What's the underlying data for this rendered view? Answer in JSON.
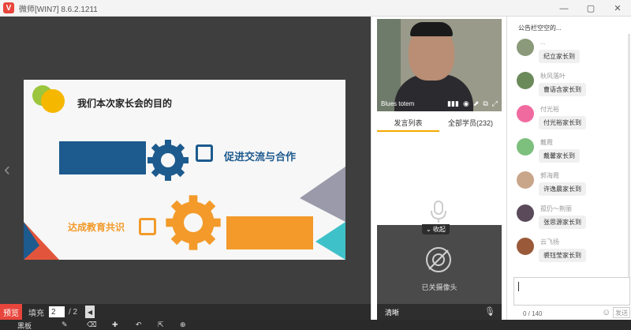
{
  "window": {
    "title": "微师[WIN7] 8.6.2.1211",
    "logo_letter": "V",
    "controls": [
      "—",
      "▢",
      "✕"
    ]
  },
  "slide": {
    "title": "我们本次家长会的目的",
    "point1": "促进交流与合作",
    "point2": "达成教育共识",
    "colors": {
      "blue": "#1d5a8e",
      "orange": "#f39a2a",
      "green": "#9bc53d",
      "yellow": "#f6b700"
    }
  },
  "stage": {
    "prev_arrow": "‹",
    "preview_button": "预览",
    "fill_label": "填充",
    "page_current": "2",
    "page_total": "/ 2",
    "page_prev": "◀"
  },
  "toolbar": {
    "items": [
      "黑板",
      "✎",
      "⌫",
      "✚",
      "↶",
      "⇱",
      "⊕"
    ]
  },
  "video": {
    "speaker_name": "Blues totem",
    "controls": [
      "▮▮▮",
      "◉",
      "⬈",
      "⧉",
      "⤢"
    ]
  },
  "tabs": [
    {
      "label": "发言列表",
      "active": true
    },
    {
      "label": "全部学员(232)",
      "active": false
    }
  ],
  "camera": {
    "collapse_label": "⌄ 收起",
    "off_text": "已关摄像头",
    "clear_label": "清晰",
    "mic_icon": "🎙"
  },
  "chat": {
    "notice": "公告栏空空的...",
    "messages": [
      {
        "name": "...",
        "text": "纪立家长到",
        "avatar_color": "#8a9a7a"
      },
      {
        "name": "秋风落叶",
        "text": "曹语含家长到",
        "avatar_color": "#6b8a5a"
      },
      {
        "name": "付光裕",
        "text": "付光裕家长到",
        "avatar_color": "#f06aa0"
      },
      {
        "name": "戴霞",
        "text": "戴馨家长到",
        "avatar_color": "#7dbf7d"
      },
      {
        "name": "郭海霞",
        "text": "许逸晨家长到",
        "avatar_color": "#c9a58a"
      },
      {
        "name": "孤仍～荆丽",
        "text": "张思源家长到",
        "avatar_color": "#5a4a5a"
      },
      {
        "name": "云飞扬",
        "text": "裘钰莹家长到",
        "avatar_color": "#9a5a3a"
      }
    ],
    "counter": "0 / 140",
    "emoji_icon": "☺",
    "send_label": "发送"
  }
}
